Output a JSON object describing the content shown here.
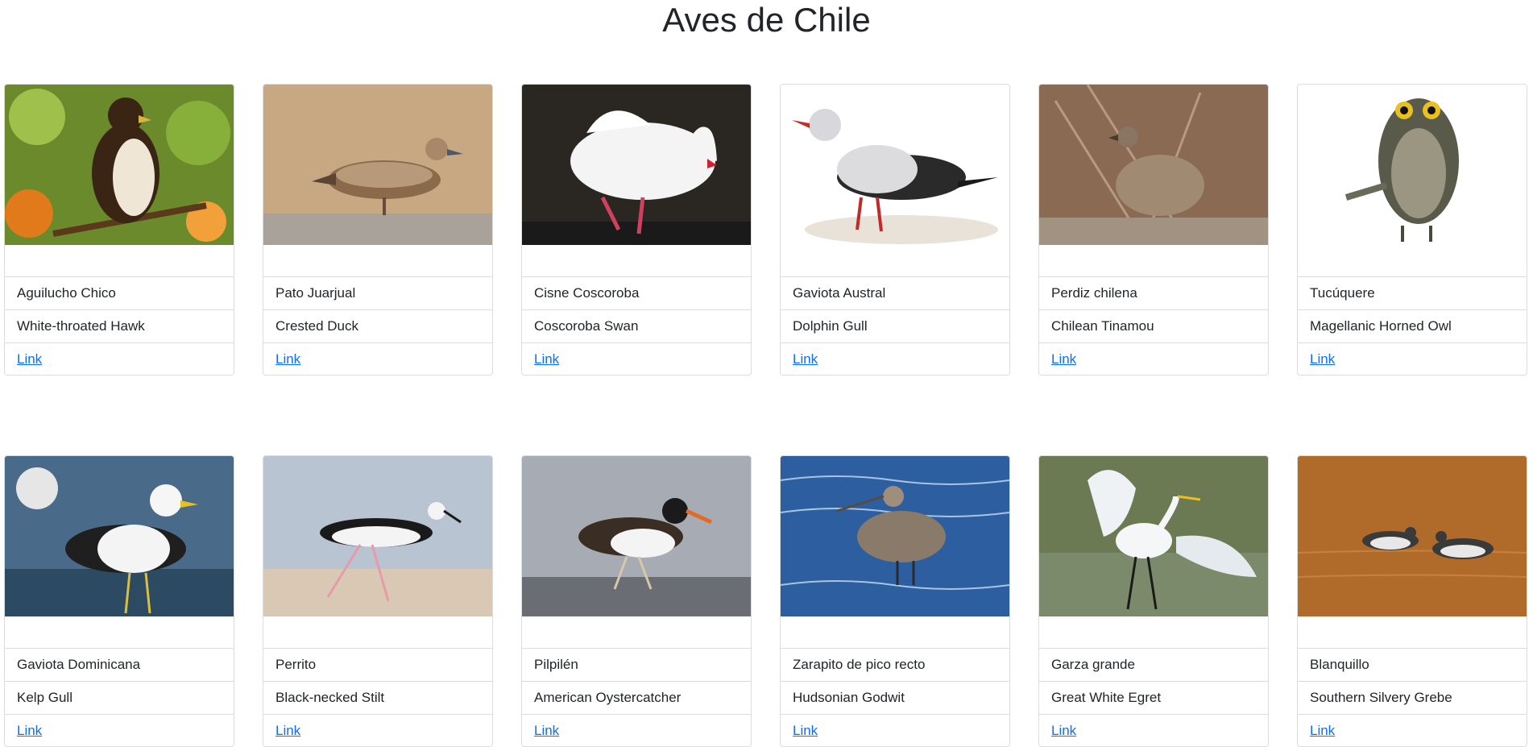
{
  "page": {
    "title": "Aves de Chile"
  },
  "cards": [
    {
      "spanish": "Aguilucho Chico",
      "english": "White-throated Hawk",
      "link": "Link",
      "image_icon": "hawk-photo",
      "bg": "#6a8a2c"
    },
    {
      "spanish": "Pato Juarjual",
      "english": "Crested Duck",
      "link": "Link",
      "image_icon": "duck-photo",
      "bg": "#c8a882"
    },
    {
      "spanish": "Cisne Coscoroba",
      "english": "Coscoroba Swan",
      "link": "Link",
      "image_icon": "swan-photo",
      "bg": "#2a2622"
    },
    {
      "spanish": "Gaviota Austral",
      "english": "Dolphin Gull",
      "link": "Link",
      "image_icon": "gull-photo",
      "bg": "#ffffff"
    },
    {
      "spanish": "Perdiz chilena",
      "english": "Chilean Tinamou",
      "link": "Link",
      "image_icon": "tinamou-photo",
      "bg": "#8a6a52"
    },
    {
      "spanish": "Tucúquere",
      "english": "Magellanic Horned Owl",
      "link": "Link",
      "image_icon": "owl-illustration",
      "bg": "#ffffff"
    },
    {
      "spanish": "Gaviota Dominicana",
      "english": "Kelp Gull",
      "link": "Link",
      "image_icon": "kelp-gull-photo",
      "bg": "#4a6a8a"
    },
    {
      "spanish": "Perrito",
      "english": "Black-necked Stilt",
      "link": "Link",
      "image_icon": "stilt-photo",
      "bg": "#b8c4d2"
    },
    {
      "spanish": "Pilpilén",
      "english": "American Oystercatcher",
      "link": "Link",
      "image_icon": "oystercatcher-photo",
      "bg": "#a7acb4"
    },
    {
      "spanish": "Zarapito de pico recto",
      "english": "Hudsonian Godwit",
      "link": "Link",
      "image_icon": "godwit-photo",
      "bg": "#2d5ea0"
    },
    {
      "spanish": "Garza grande",
      "english": "Great White Egret",
      "link": "Link",
      "image_icon": "egret-photo",
      "bg": "#6b7a52"
    },
    {
      "spanish": "Blanquillo",
      "english": "Southern Silvery Grebe",
      "link": "Link",
      "image_icon": "grebe-photo",
      "bg": "#b06a2a"
    }
  ]
}
